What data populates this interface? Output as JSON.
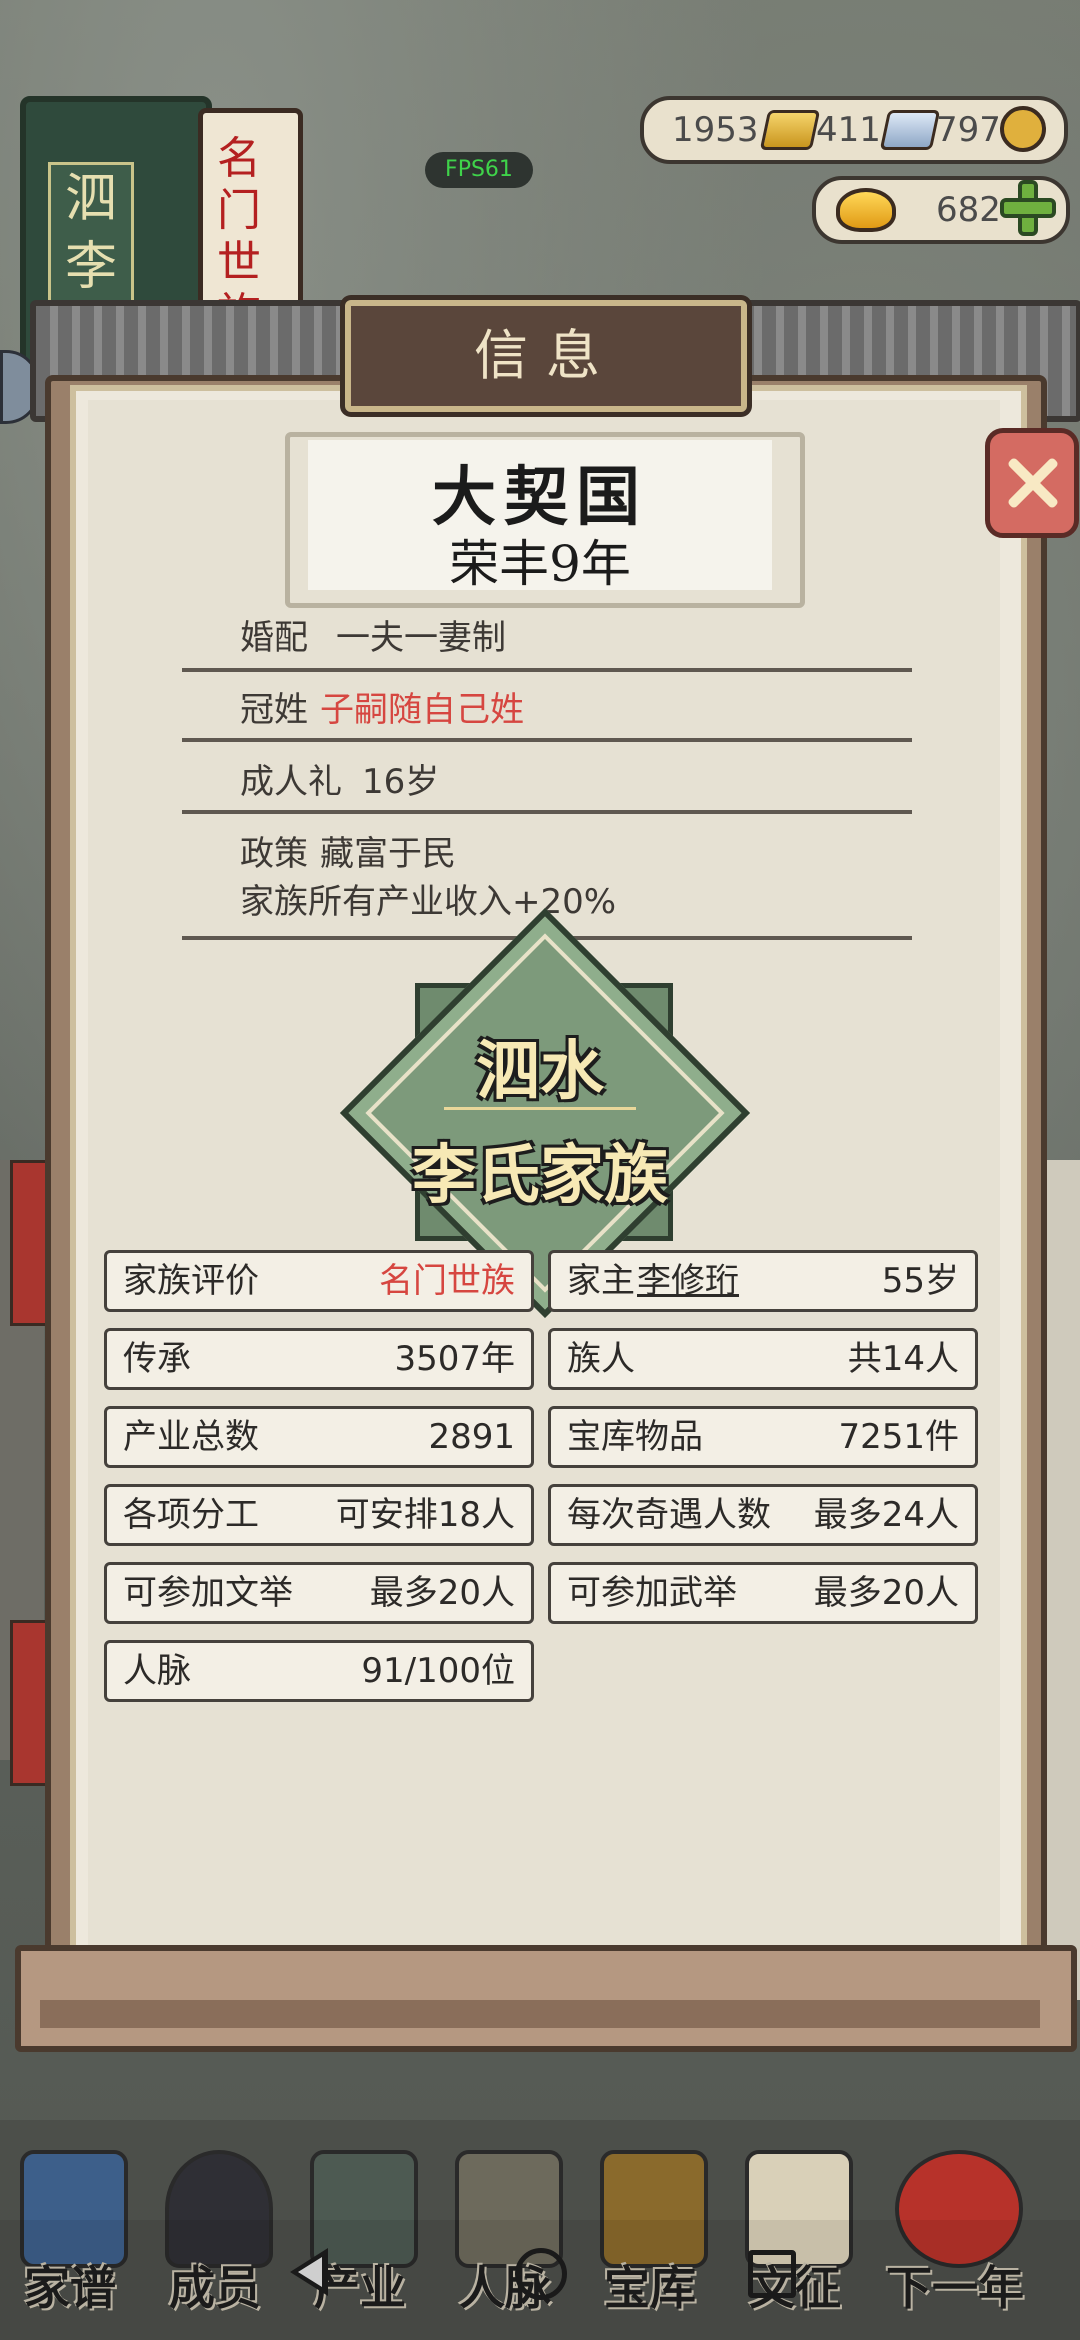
{
  "hud": {
    "fps": "FPS61",
    "gold_bars": "1953",
    "silver_bars": "411",
    "coins": "797",
    "ingots": "682"
  },
  "background_book": {
    "title": "泗水\n李氏",
    "subtitle": "名门世族"
  },
  "dialog": {
    "title": "信息",
    "country": "大契国",
    "era_year": "荣丰9年",
    "marriage_label": "婚配",
    "marriage_value": "一夫一妻制",
    "surname_label": "冠姓",
    "surname_value": "子嗣随自己姓",
    "adulthood_label": "成人礼",
    "adulthood_value": "16岁",
    "policy_label": "政策",
    "policy_value": "藏富于民",
    "policy_effect": "家族所有产业收入+20%",
    "emblem_line1": "泗水",
    "emblem_line2": "李氏家族"
  },
  "stats": {
    "rating_label": "家族评价",
    "rating_value": "名门世族",
    "head_label": "家主",
    "head_name": "李修珩",
    "head_age": "55岁",
    "heritage_label": "传承",
    "heritage_value": "3507年",
    "members_label": "族人",
    "members_value": "共14人",
    "industries_label": "产业总数",
    "industries_value": "2891",
    "treasury_label": "宝库物品",
    "treasury_value": "7251件",
    "division_label": "各项分工",
    "division_value": "可安排18人",
    "encounter_label": "每次奇遇人数",
    "encounter_value": "最多24人",
    "civil_exam_label": "可参加文举",
    "civil_exam_value": "最多20人",
    "military_exam_label": "可参加武举",
    "military_exam_value": "最多20人",
    "network_label": "人脉",
    "network_value": "91/100位"
  },
  "nav": [
    "家谱",
    "成员",
    "产业",
    "人脉",
    "宝库",
    "文征",
    "下一年"
  ],
  "colors": {
    "accent_red": "#d64640",
    "panel_paper": "#ede8dc",
    "emblem_green": "#7d9a7b"
  }
}
